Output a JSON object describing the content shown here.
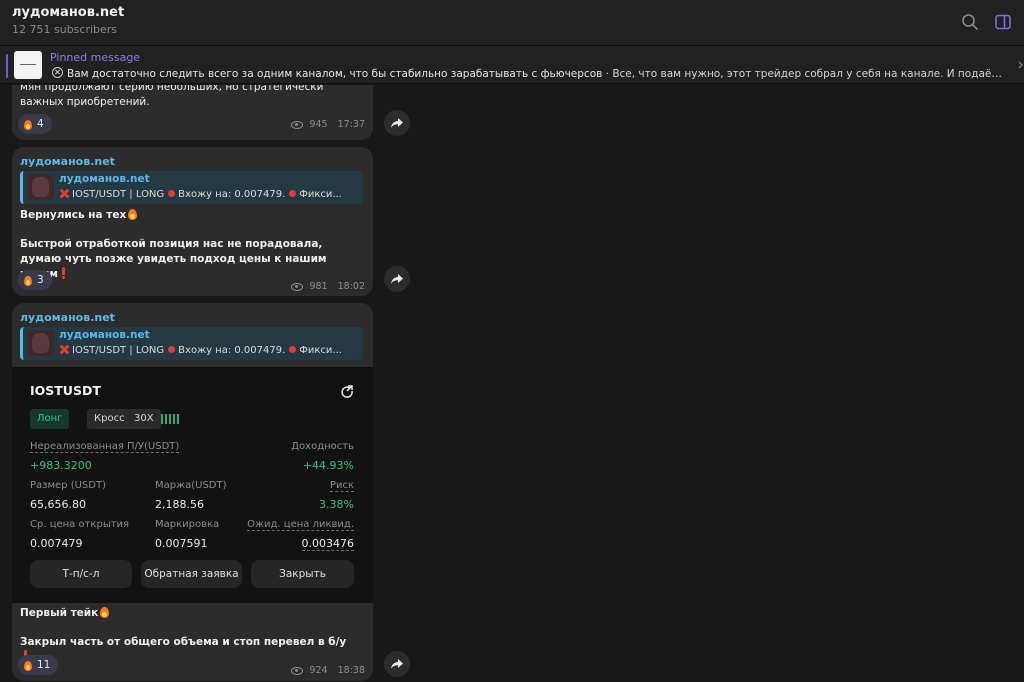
{
  "channel": {
    "title": "лудоманов.net",
    "subscribers": "12 751 subscribers"
  },
  "header_icons": [
    "search-icon",
    "sidebar-toggle-icon"
  ],
  "pinned": {
    "label": "Pinned message",
    "text_bold": "Вам достаточно следить всего за одним каналом, что бы стабильно зарабатывать с фьючерсов",
    "text_rest": " · Все, что вам нужно, этот трейдер собрал у себя на канале. И подаёт вес..."
  },
  "messages": [
    {
      "text": "мян продолжают серию небольших, но стратегически важных приобретений.",
      "reaction_count": "4",
      "views": "945",
      "time": "17:37"
    },
    {
      "author": "лудоманов.net",
      "reply_author": "лудоманов.net",
      "reply_pair": "IOST/USDT | LONG",
      "reply_entry": "Вхожу на: 0.007479.",
      "reply_tail": "Фикси...",
      "line1": "Вернулись на тех",
      "line2": "Быстрой отработкой позиция нас не порадовала, думаю чуть позже увидеть подход цены к нашим целям",
      "reaction_count": "3",
      "views": "981",
      "time": "18:02"
    },
    {
      "author": "лудоманов.net",
      "reply_author": "лудоманов.net",
      "reply_pair": "IOST/USDT | LONG",
      "reply_entry": "Вхожу на: 0.007479.",
      "reply_tail": "Фикси...",
      "line1": "Первый тейк",
      "line2": "Закрыл часть от общего объема и стоп перевел в б/у",
      "reaction_count": "11",
      "views": "924",
      "time": "18:38"
    }
  ],
  "trade_card": {
    "pair": "IOSTUSDT",
    "side": "Лонг",
    "margin_mode": "Кросс",
    "leverage": "30X",
    "pnl_label": "Нереализованная П/У(USDT)",
    "pnl_value": "+983.3200",
    "roi_label": "Доходность",
    "roi_value": "+44.93%",
    "size_label": "Размер (USDT)",
    "size_value": "65,656.80",
    "margin_label": "Маржа(USDT)",
    "margin_value": "2,188.56",
    "risk_label": "Риск",
    "risk_value": "3.38%",
    "open_label": "Ср. цена открытия",
    "open_value": "0.007479",
    "mark_label": "Маркировка",
    "mark_value": "0.007591",
    "liq_label": "Ожид. цена ликвид.",
    "liq_value": "0.003476",
    "btn_tpsl": "Т-п/с-л",
    "btn_reverse": "Обратная заявка",
    "btn_close": "Закрыть",
    "colors": {
      "long": "#36c084",
      "background": "#121212"
    }
  }
}
